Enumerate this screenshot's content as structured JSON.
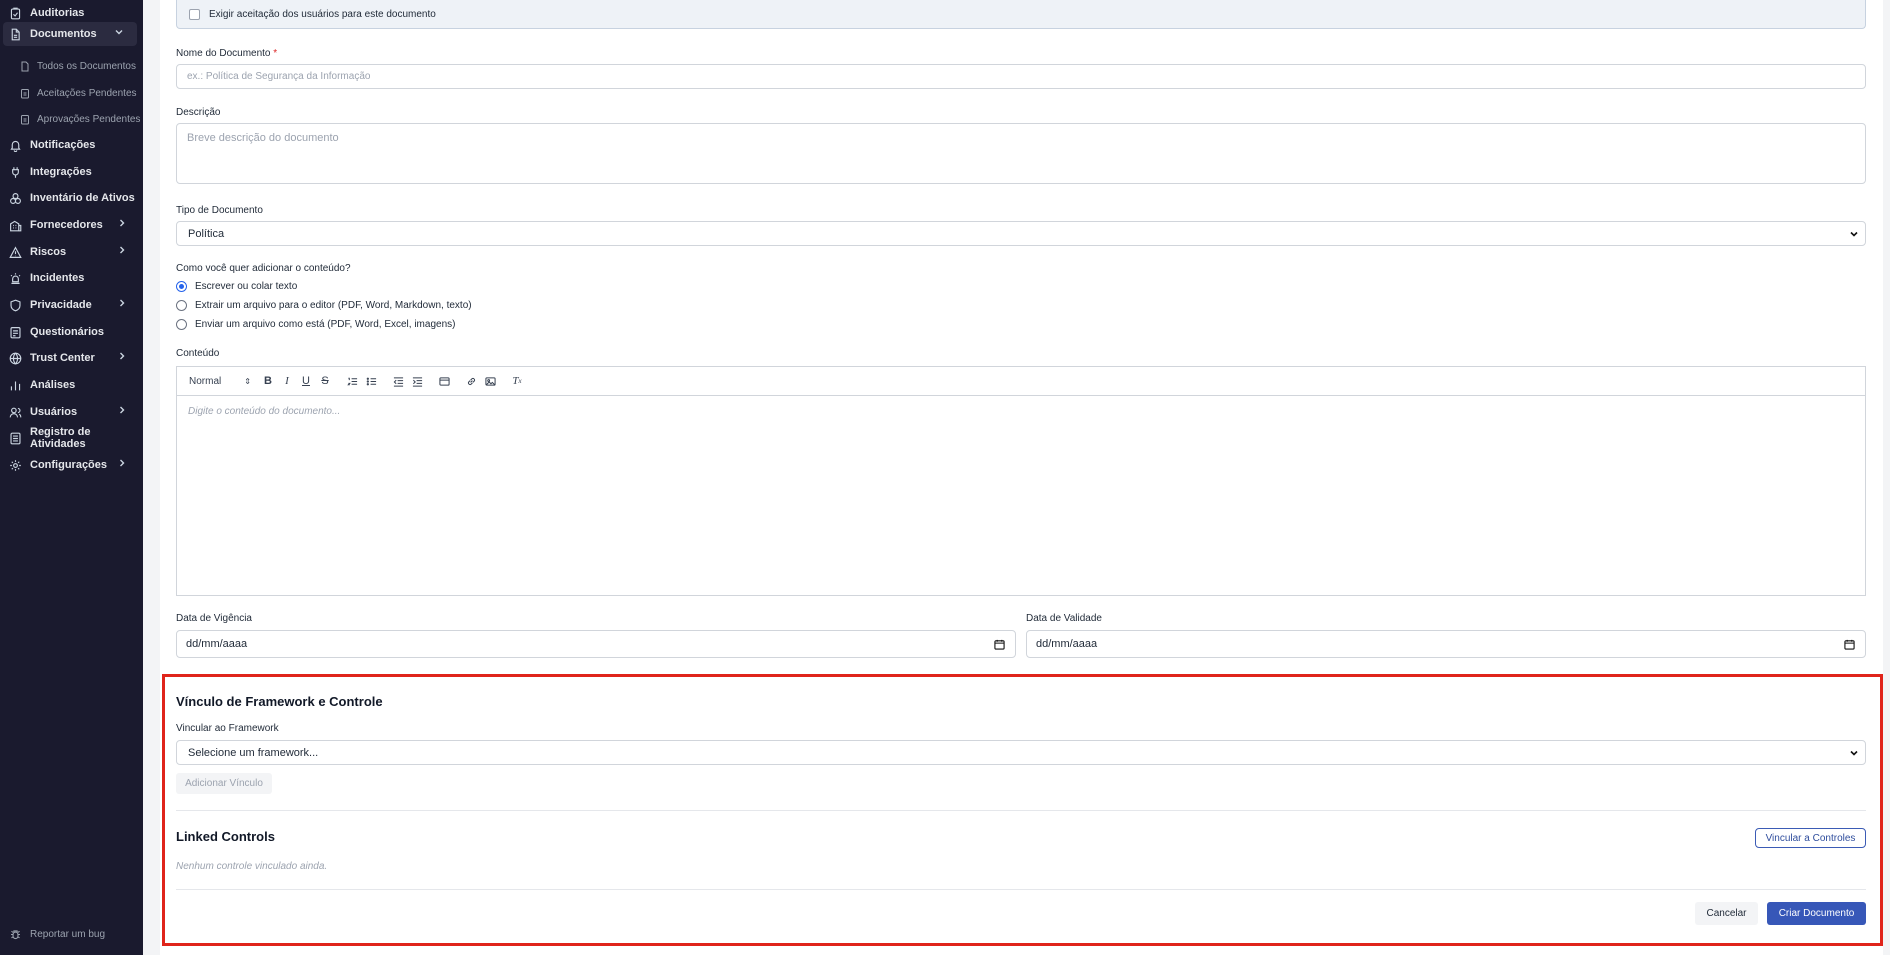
{
  "sidebar": {
    "items": [
      {
        "label": "Auditorias",
        "icon": "clipboard-check-icon"
      },
      {
        "label": "Documentos",
        "icon": "document-icon",
        "expanded": true
      },
      {
        "label": "Notificações",
        "icon": "bell-icon"
      },
      {
        "label": "Integrações",
        "icon": "plug-icon"
      },
      {
        "label": "Inventário de Ativos",
        "icon": "assets-icon"
      },
      {
        "label": "Fornecedores",
        "icon": "building-icon"
      },
      {
        "label": "Riscos",
        "icon": "warning-triangle-icon"
      },
      {
        "label": "Incidentes",
        "icon": "siren-icon"
      },
      {
        "label": "Privacidade",
        "icon": "shield-icon"
      },
      {
        "label": "Questionários",
        "icon": "questionnaire-icon"
      },
      {
        "label": "Trust Center",
        "icon": "globe-icon"
      },
      {
        "label": "Análises",
        "icon": "bar-chart-icon"
      },
      {
        "label": "Usuários",
        "icon": "users-icon"
      },
      {
        "label": "Registro de Atividades",
        "icon": "activity-log-icon"
      },
      {
        "label": "Configurações",
        "icon": "gear-icon"
      }
    ],
    "sub_items": [
      {
        "label": "Todos os Documentos"
      },
      {
        "label": "Aceitações Pendentes"
      },
      {
        "label": "Aprovações Pendentes"
      }
    ],
    "report_bug": "Reportar um bug"
  },
  "form": {
    "require_acceptance": "Exigir aceitação dos usuários para este documento",
    "name_label": "Nome do Documento",
    "required_mark": "*",
    "name_placeholder": "ex.: Política de Segurança da Informação",
    "description_label": "Descrição",
    "description_placeholder": "Breve descrição do documento",
    "type_label": "Tipo de Documento",
    "type_value": "Política",
    "content_question": "Como você quer adicionar o conteúdo?",
    "content_options": [
      {
        "label": "Escrever ou colar texto",
        "selected": true
      },
      {
        "label": "Extrair um arquivo para o editor (PDF, Word, Markdown, texto)",
        "selected": false
      },
      {
        "label": "Enviar um arquivo como está (PDF, Word, Excel, imagens)",
        "selected": false
      }
    ],
    "content_label": "Conteúdo",
    "editor_format": "Normal",
    "editor_placeholder": "Digite o conteúdo do documento...",
    "effective_label": "Data de Vigência",
    "effective_value": "dd/mm/aaaa",
    "expiry_label": "Data de Validade",
    "expiry_value": "dd/mm/aaaa"
  },
  "framework": {
    "title": "Vínculo de Framework e Controle",
    "link_label": "Vincular ao Framework",
    "select_value": "Selecione um framework...",
    "add_button": "Adicionar Vínculo",
    "linked_title": "Linked Controls",
    "link_controls_button": "Vincular a Controles",
    "empty_text": "Nenhum controle vinculado ainda."
  },
  "actions": {
    "cancel": "Cancelar",
    "create": "Criar Documento"
  },
  "colors": {
    "sidebar_bg": "#1a1a2e",
    "primary": "#3757b8",
    "highlight": "#e0241b"
  }
}
